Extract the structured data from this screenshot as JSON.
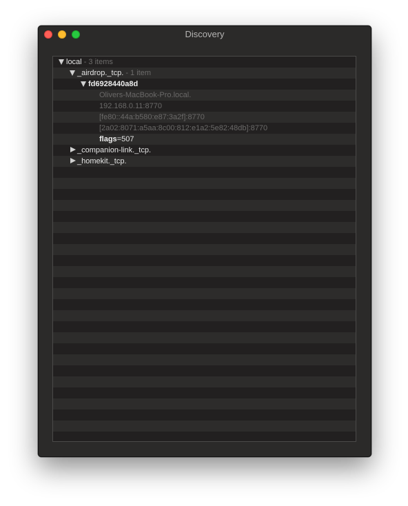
{
  "window": {
    "title": "Discovery"
  },
  "tree": {
    "local": {
      "label": "local",
      "count": "- 3 items"
    },
    "airdrop": {
      "label": "_airdrop._tcp.",
      "count": "- 1 item"
    },
    "device": {
      "id": "fd6928440a8d",
      "hostname": "Olivers-MacBook-Pro.local.",
      "addresses": [
        "192.168.0.11:8770",
        "[fe80::44a:b580:e87:3a2f]:8770",
        "[2a02:8071:a5aa:8c00:812:e1a2:5e82:48db]:8770"
      ],
      "flags_key": "flags",
      "flags_value": "=507"
    },
    "companion": {
      "label": "_companion-link._tcp."
    },
    "homekit": {
      "label": "_homekit._tcp."
    }
  }
}
